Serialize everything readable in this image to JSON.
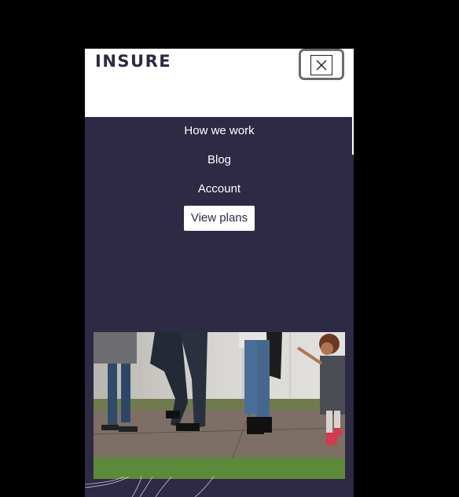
{
  "header": {
    "logo_text": "INSURE"
  },
  "nav": {
    "items": [
      {
        "label": "How we work"
      },
      {
        "label": "Blog"
      },
      {
        "label": "Account"
      }
    ],
    "cta_label": "View plans"
  },
  "icons": {
    "close": "close-icon"
  },
  "colors": {
    "nav_bg": "#2e2945",
    "header_bg": "#ffffff",
    "cta_bg": "#ffffff",
    "page_bg": "#000000"
  }
}
